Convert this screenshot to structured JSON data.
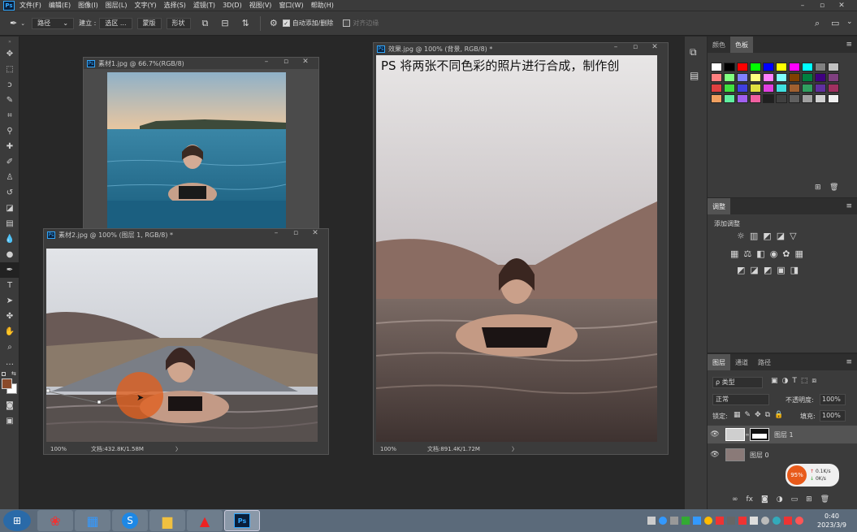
{
  "menubar": {
    "logo": "Ps",
    "items": [
      "文件(F)",
      "编辑(E)",
      "图像(I)",
      "图层(L)",
      "文字(Y)",
      "选择(S)",
      "滤镜(T)",
      "3D(D)",
      "视图(V)",
      "窗口(W)",
      "帮助(H)"
    ]
  },
  "options": {
    "mode": "路径",
    "build_label": "建立 :",
    "selection_btn": "选区 ...",
    "mask_btn": "蒙版",
    "shape_btn": "形状",
    "auto_add_label": "自动添加/删除",
    "align_edges_label": "对齐边缘"
  },
  "documents": {
    "doc1": {
      "title": "素材1.jpg @ 66.7%(RGB/8)"
    },
    "doc2": {
      "title": "素材2.jpg @ 100% (图层 1, RGB/8) *",
      "zoom": "100%",
      "docinfo": "文档:432.8K/1.58M",
      "arrow": "〉"
    },
    "doc3": {
      "title": "效果.jpg @ 100% (背景, RGB/8) *",
      "zoom": "100%",
      "docinfo": "文档:891.4K/1.72M",
      "arrow": "〉",
      "overlay_text": "PS 将两张不同色彩的照片进行合成，制作创"
    }
  },
  "swatches_panel": {
    "tabs": [
      "颜色",
      "色板"
    ],
    "colors": [
      "#ffffff",
      "#000000",
      "#ff0000",
      "#00ff00",
      "#0000ff",
      "#ffff00",
      "#ff00ff",
      "#00ffff",
      "#808080",
      "#c0c0c0",
      "#ff8080",
      "#80ff80",
      "#8080ff",
      "#ffff80",
      "#ff80ff",
      "#80ffff",
      "#804000",
      "#008040",
      "#400080",
      "#804080",
      "#e04040",
      "#40e040",
      "#4040e0",
      "#e0e040",
      "#e040e0",
      "#40e0e0",
      "#a06030",
      "#30a060",
      "#6030a0",
      "#a03060",
      "#f0a060",
      "#60f0a0",
      "#a060f0",
      "#f060a0",
      "#202020",
      "#404040",
      "#606060",
      "#a0a0a0",
      "#d0d0d0",
      "#f0f0f0"
    ]
  },
  "adjustments_panel": {
    "tab": "调整",
    "label": "添加调整"
  },
  "layers_panel": {
    "tabs": [
      "图层",
      "通道",
      "路径"
    ],
    "filter_label": "ρ 类型",
    "blend_mode": "正常",
    "opacity_label": "不透明度:",
    "opacity": "100%",
    "lock_label": "锁定:",
    "fill_label": "填充:",
    "fill": "100%",
    "layers": [
      {
        "name": "图层 1"
      },
      {
        "name": "图层 0"
      }
    ],
    "net_widget": {
      "percent": "95%",
      "up": "0.1K/s",
      "down": "0K/s"
    }
  },
  "taskbar": {
    "time": "0:40",
    "date": "2023/3/9"
  },
  "colors": {
    "ui_bg": "#3b3b3b",
    "canvas_bg": "#282828",
    "accent": "#31a8ff",
    "brush": "#e06020"
  }
}
